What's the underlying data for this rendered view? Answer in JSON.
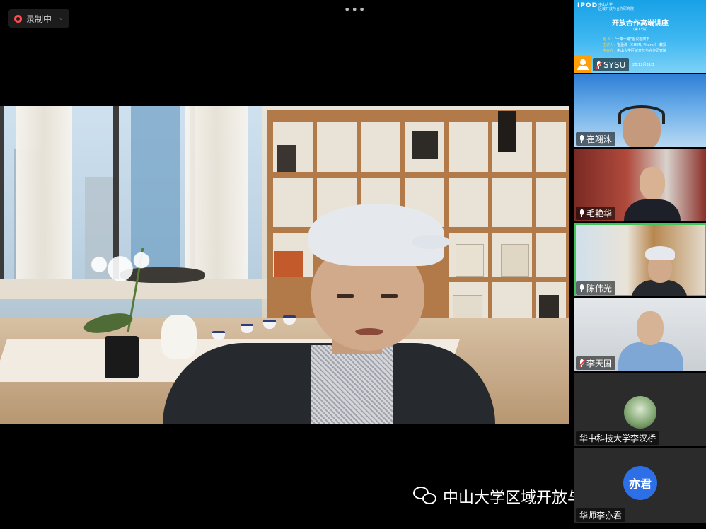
{
  "recording": {
    "label": "录制中"
  },
  "toolbar": {
    "more_label": "•••"
  },
  "main_video": {
    "speaker": "陈伟光"
  },
  "slide": {
    "logo": "IPOD",
    "subtitle_line1": "中山大学",
    "subtitle_line2": "区域开放与合作研究院",
    "title": "开放合作高端讲座",
    "issue": "（第13讲）",
    "lines": [
      {
        "label": "题  目：",
        "value": "\"一带一路\"倡议框架下..."
      },
      {
        "label": "主讲人：",
        "value": "崔盈涞（CHEN, Pitarsr） 教授"
      },
      {
        "label": "主办方：",
        "value": "中山大学区域开放与合作研究院"
      }
    ],
    "date_fragment": "2年12月31日"
  },
  "participants": [
    {
      "name": "SYSU",
      "mic": "muted",
      "host": true
    },
    {
      "name": "崔翊涞",
      "mic": "on"
    },
    {
      "name": "毛艳华",
      "mic": "on"
    },
    {
      "name": "陈伟光",
      "mic": "on",
      "active": true
    },
    {
      "name": "李天国",
      "mic": "muted"
    },
    {
      "name": "华中科技大学李汉桥",
      "mic": "none"
    },
    {
      "name": "华师李亦君",
      "mic": "none",
      "avatar_text": "亦君"
    }
  ],
  "watermark": {
    "text": "中山大学区域开放与合作研究院"
  },
  "colors": {
    "active_border": "#3fc55a",
    "slide_blue": "#17a1e6",
    "record_red": "#ff4d4f"
  }
}
